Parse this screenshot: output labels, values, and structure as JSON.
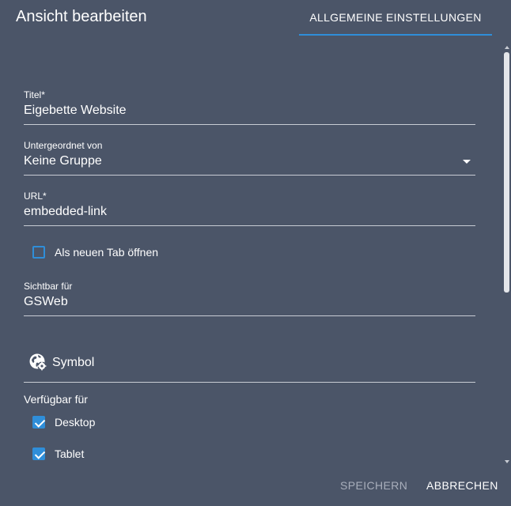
{
  "dialog": {
    "title": "Ansicht bearbeiten",
    "tab_label": "ALLGEMEINE EINSTELLUNGEN",
    "accent_color": "#2f8ed9",
    "background_color": "#4b5568"
  },
  "form": {
    "title_field": {
      "label": "Titel*",
      "value": "Eigebette Website"
    },
    "parent_field": {
      "label": "Untergeordnet von",
      "value": "Keine Gruppe"
    },
    "url_field": {
      "label": "URL*",
      "value": "embedded-link"
    },
    "new_tab": {
      "label": "Als neuen Tab öffnen",
      "checked": false
    },
    "visible_for_field": {
      "label": "Sichtbar für",
      "value": "GSWeb"
    },
    "symbol": {
      "label": "Symbol",
      "icon": "globe-settings-icon"
    },
    "available_for": {
      "label": "Verfügbar für",
      "options": [
        {
          "label": "Desktop",
          "checked": true
        },
        {
          "label": "Tablet",
          "checked": true
        }
      ]
    }
  },
  "footer": {
    "save_label": "SPEICHERN",
    "cancel_label": "ABBRECHEN"
  }
}
